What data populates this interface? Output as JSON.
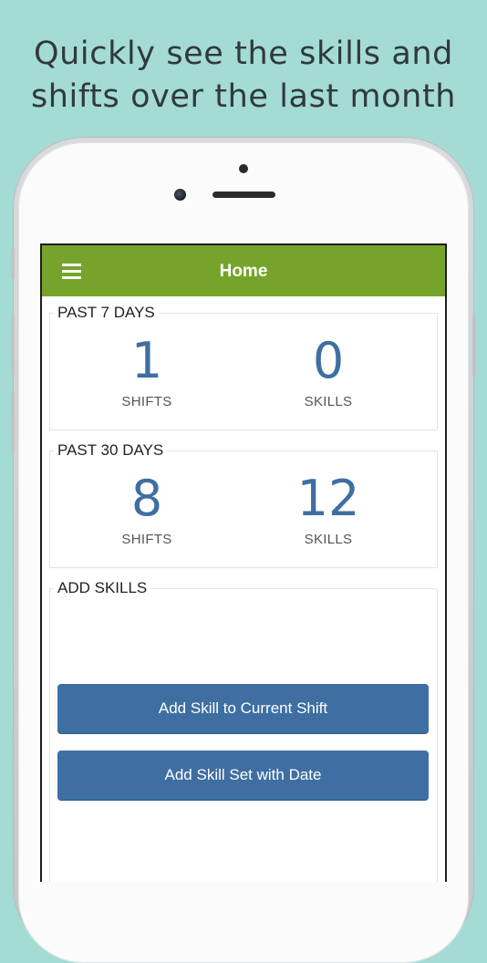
{
  "headline": {
    "line1": "Quickly see the skills and",
    "line2": "shifts over the last month"
  },
  "navbar": {
    "title": "Home",
    "menu_icon": "hamburger-menu-icon",
    "color": "#76a42b"
  },
  "past7": {
    "title": "PAST 7 DAYS",
    "shifts_value": "1",
    "shifts_label": "SHIFTS",
    "skills_value": "0",
    "skills_label": "SKILLS"
  },
  "past30": {
    "title": "PAST 30 DAYS",
    "shifts_value": "8",
    "shifts_label": "SHIFTS",
    "skills_value": "12",
    "skills_label": "SKILLS"
  },
  "add_skills": {
    "title": "ADD SKILLS",
    "add_to_shift_label": "Add Skill to Current Shift",
    "add_with_date_label": "Add Skill Set with Date"
  },
  "colors": {
    "background": "#a5dbd5",
    "accent_blue": "#3f6fa2"
  }
}
